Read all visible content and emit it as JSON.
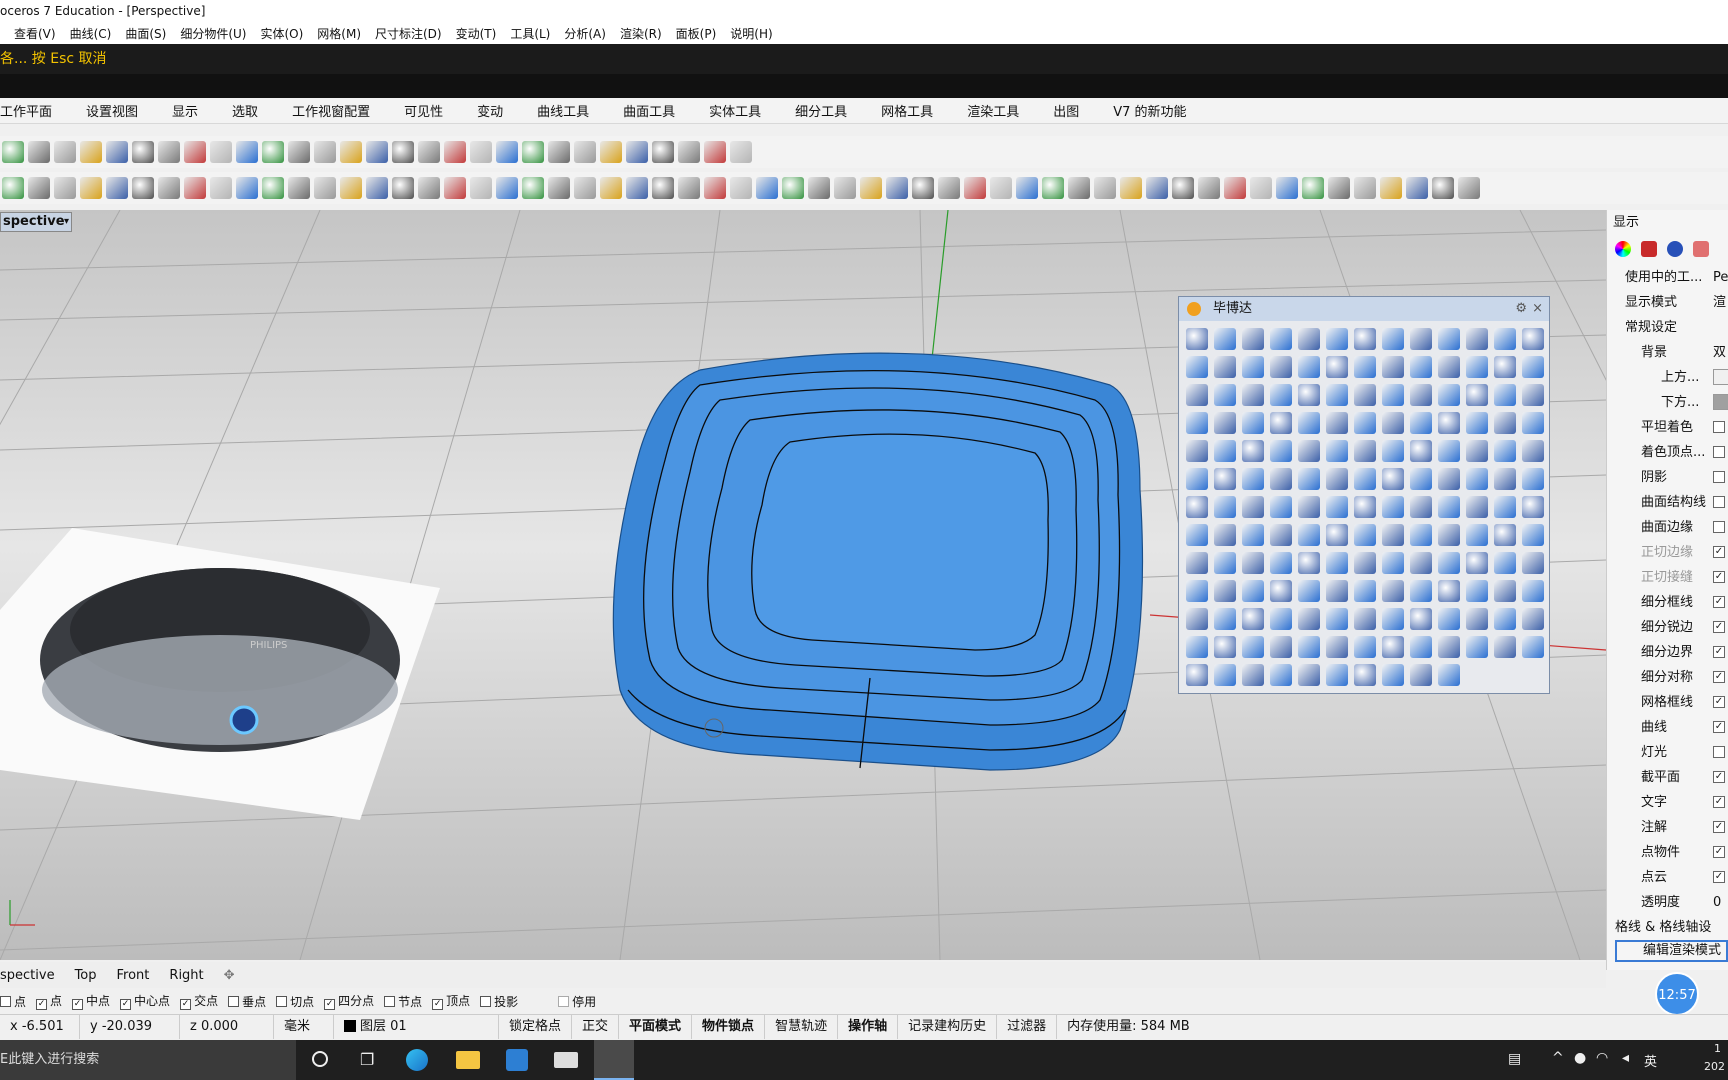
{
  "window": {
    "title": "oceros 7 Education - [Perspective]"
  },
  "menu": [
    "查看(V)",
    "曲线(C)",
    "曲面(S)",
    "细分物件(U)",
    "实体(O)",
    "网格(M)",
    "尺寸标注(D)",
    "变动(T)",
    "工具(L)",
    "分析(A)",
    "渲染(R)",
    "面板(P)",
    "说明(H)"
  ],
  "command": {
    "prompt": "各... 按 Esc 取消"
  },
  "toolbar_tabs": [
    "工作平面",
    "设置视图",
    "显示",
    "选取",
    "工作视窗配置",
    "可见性",
    "变动",
    "曲线工具",
    "曲面工具",
    "实体工具",
    "细分工具",
    "网格工具",
    "渲染工具",
    "出图",
    "V7 的新功能"
  ],
  "viewport": {
    "label": "spective",
    "reference_image_text": "PHILIPS"
  },
  "viewport_tabs": [
    "spective",
    "Top",
    "Front",
    "Right"
  ],
  "add_tab_icon": "plus-icon",
  "panel": {
    "title": "毕博达"
  },
  "osnaps": [
    {
      "label": "点",
      "checked": false
    },
    {
      "label": "点",
      "checked": true
    },
    {
      "label": "中点",
      "checked": true
    },
    {
      "label": "中心点",
      "checked": true
    },
    {
      "label": "交点",
      "checked": true
    },
    {
      "label": "垂点",
      "checked": false
    },
    {
      "label": "切点",
      "checked": false
    },
    {
      "label": "四分点",
      "checked": true
    },
    {
      "label": "节点",
      "checked": false
    },
    {
      "label": "顶点",
      "checked": true
    },
    {
      "label": "投影",
      "checked": false
    },
    {
      "label": "停用",
      "checked": false
    }
  ],
  "status": {
    "x": "x -6.501",
    "y": "y -20.039",
    "z": "z 0.000",
    "unit": "毫米",
    "layer": "图层 01",
    "buttons": [
      "锁定格点",
      "正交",
      "平面模式",
      "物件锁点",
      "智慧轨迹",
      "操作轴",
      "记录建构历史",
      "过滤器"
    ],
    "memory": "内存使用量: 584 MB"
  },
  "display_panel": {
    "title": "显示",
    "rows_top": [
      {
        "label": "使用中的工...",
        "value": "Pe"
      },
      {
        "label": "显示模式",
        "value": "渲"
      }
    ],
    "section": "常规设定",
    "background": {
      "label": "背景",
      "value": "双"
    },
    "above": "上方...",
    "below": "下方...",
    "options": [
      {
        "label": "平坦着色",
        "checked": false
      },
      {
        "label": "着色顶点...",
        "checked": false
      },
      {
        "label": "阴影",
        "checked": false
      },
      {
        "label": "曲面结构线",
        "checked": false
      },
      {
        "label": "曲面边缘",
        "checked": false
      },
      {
        "label": "正切边缘",
        "checked": true
      },
      {
        "label": "正切接缝",
        "checked": true
      },
      {
        "label": "细分框线",
        "checked": true
      },
      {
        "label": "细分锐边",
        "checked": true
      },
      {
        "label": "细分边界",
        "checked": true
      },
      {
        "label": "细分对称",
        "checked": true
      },
      {
        "label": "网格框线",
        "checked": true
      },
      {
        "label": "曲线",
        "checked": true
      },
      {
        "label": "灯光",
        "checked": false
      },
      {
        "label": "截平面",
        "checked": true
      },
      {
        "label": "文字",
        "checked": true
      },
      {
        "label": "注解",
        "checked": true
      },
      {
        "label": "点物件",
        "checked": true
      },
      {
        "label": "点云",
        "checked": true
      }
    ],
    "transparency": {
      "label": "透明度",
      "value": "0"
    },
    "grid_section": "格线 & 格线轴设",
    "edit_button": "编辑渲染模式"
  },
  "clock_badge": "12:57",
  "taskbar": {
    "search_placeholder": "E此键入进行搜索",
    "ime": "英",
    "time_partial": "1",
    "date_partial": "202"
  }
}
